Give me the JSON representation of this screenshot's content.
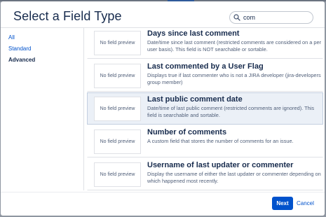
{
  "dialog": {
    "title": "Select a Field Type"
  },
  "search": {
    "value": "com",
    "placeholder": ""
  },
  "nav": {
    "items": [
      {
        "label": "All",
        "active": false
      },
      {
        "label": "Standard",
        "active": false
      },
      {
        "label": "Advanced",
        "active": true
      }
    ]
  },
  "fields": [
    {
      "preview": "No field preview",
      "title": "Days since last comment",
      "description": "Date/time since last comment (restricted comments are considered on a per user basis). This field is NOT searchable or sortable.",
      "selected": false
    },
    {
      "preview": "No field preview",
      "title": "Last commented by a User Flag",
      "description": "Displays true if last commenter who is not a JIRA developer (jira-developers group member)",
      "selected": false
    },
    {
      "preview": "No field preview",
      "title": "Last public comment date",
      "description": "Date/time of last public comment (restricted comments are ignored). This field is searchable and sortable.",
      "selected": true
    },
    {
      "preview": "No field preview",
      "title": "Number of comments",
      "description": "A custom field that stores the number of comments for an issue.",
      "selected": false
    },
    {
      "preview": "No field preview",
      "title": "Username of last updater or commenter",
      "description": "Display the username of either the last updater or commenter depending on which happened most recently.",
      "selected": false
    }
  ],
  "footer": {
    "next_label": "Next",
    "cancel_label": "Cancel"
  },
  "colors": {
    "accent": "#0052cc",
    "selected_row": "#ebf0f7",
    "text": "#172b4d"
  }
}
